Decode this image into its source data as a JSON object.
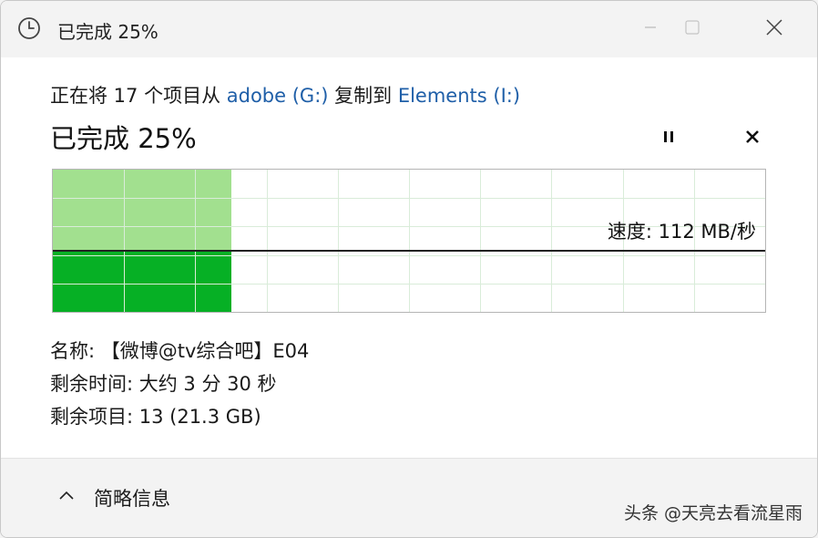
{
  "window": {
    "title": "已完成 25%"
  },
  "copy": {
    "prefix": "正在将 17 个项目从 ",
    "source": "adobe (G:)",
    "middle": " 复制到 ",
    "destination": "Elements (I:)"
  },
  "status": {
    "percent_label": "已完成 25%",
    "progress_fraction": 0.25
  },
  "graph": {
    "speed_label": "速度: 112 MB/秒"
  },
  "details": {
    "name": "名称: 【微博@tv综合吧】E04",
    "time_remaining": "剩余时间: 大约 3 分 30 秒",
    "items_remaining": "剩余项目: 13 (21.3 GB)"
  },
  "footer": {
    "brief_label": "简略信息",
    "watermark": "头条 @天亮去看流星雨"
  },
  "icons": {
    "title": "clock-icon",
    "minimize": "minimize-icon",
    "maximize": "maximize-icon",
    "close": "close-icon",
    "pause": "pause-icon",
    "cancel": "cancel-icon",
    "collapse": "chevron-up-icon"
  },
  "colors": {
    "progress_light": "#a2e08f",
    "progress_dark": "#06b025",
    "link": "#1f5fa8"
  }
}
